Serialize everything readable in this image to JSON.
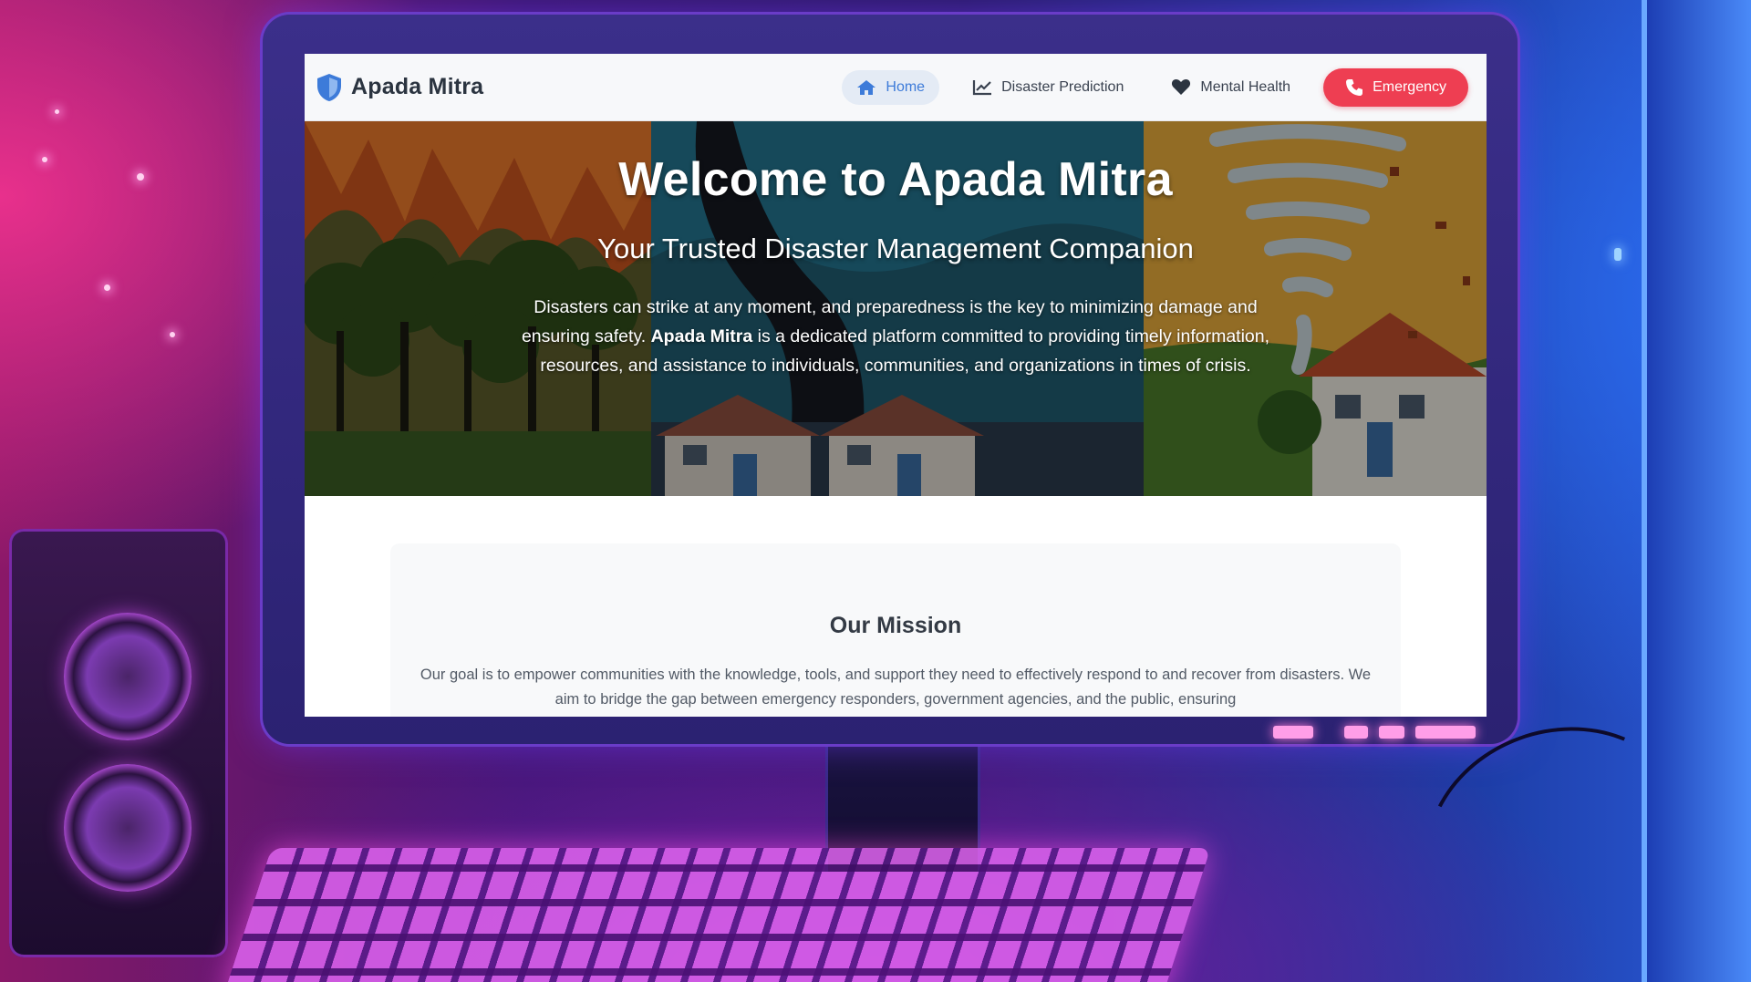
{
  "brand": {
    "name": "Apada Mitra",
    "icon": "shield-icon"
  },
  "nav": [
    {
      "label": "Home",
      "icon": "home-icon",
      "active": true
    },
    {
      "label": "Disaster Prediction",
      "icon": "chart-line-icon",
      "active": false
    },
    {
      "label": "Mental Health",
      "icon": "heart-icon",
      "active": false
    },
    {
      "label": "Emergency",
      "icon": "phone-icon",
      "active": false
    }
  ],
  "hero": {
    "title": "Welcome to Apada Mitra",
    "subtitle": "Your Trusted Disaster Management Companion",
    "text_before": "Disasters can strike at any moment, and preparedness is the key to minimizing damage and ensuring safety. ",
    "text_bold": "Apada Mitra",
    "text_after": " is a dedicated platform committed to providing timely information, resources, and assistance to individuals, communities, and organizations in times of crisis."
  },
  "mission": {
    "title": "Our Mission",
    "text": "Our goal is to empower communities with the knowledge, tools, and support they need to effectively respond to and recover from disasters. We aim to bridge the gap between emergency responders, government agencies, and the public, ensuring"
  },
  "colors": {
    "accent": "#3d7bd9",
    "emergency": "#ee3e52",
    "navbar_bg": "#f7f8fa"
  }
}
